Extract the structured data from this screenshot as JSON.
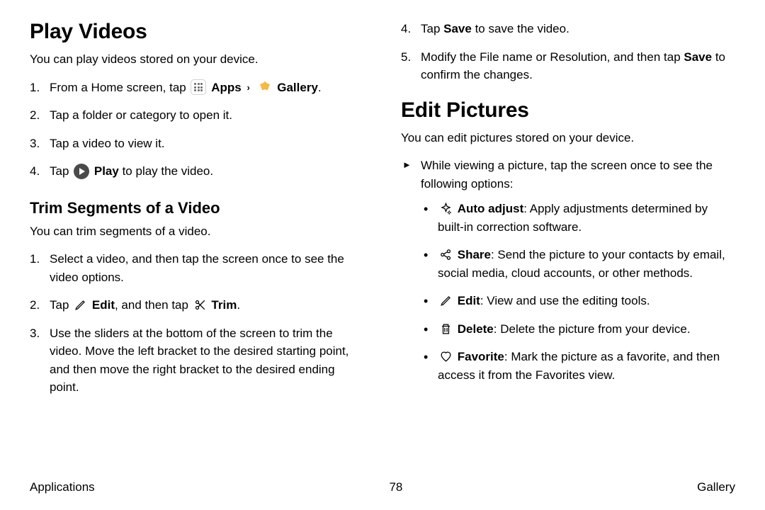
{
  "left": {
    "h1": "Play Videos",
    "intro": "You can play videos stored on your device.",
    "steps": {
      "s1a": "From a Home screen, tap ",
      "s1_apps": "Apps",
      "s1_gallery": "Gallery",
      "s1_end": ".",
      "s2": "Tap a folder or category to open it.",
      "s3": "Tap a video to view it.",
      "s4a": "Tap ",
      "s4_play": "Play",
      "s4b": " to play the video."
    },
    "h2": "Trim Segments of a Video",
    "intro2": "You can trim segments of a video.",
    "trim": {
      "t1": "Select a video, and then tap the screen once to see the video options.",
      "t2a": "Tap ",
      "t2_edit": "Edit",
      "t2b": ", and then tap ",
      "t2_trim": "Trim",
      "t2c": ".",
      "t3": "Use the sliders at the bottom of the screen to trim the video. Move the left bracket to the desired starting point, and then move the right bracket to the desired ending point."
    }
  },
  "right": {
    "cont": {
      "c4a": "Tap ",
      "c4_save": "Save",
      "c4b": " to save the video.",
      "c5a": "Modify the File name or Resolution, and then tap ",
      "c5_save": "Save",
      "c5b": " to confirm the changes."
    },
    "h1": "Edit Pictures",
    "intro": "You can edit pictures stored on your device.",
    "lead": "While viewing a picture, tap the screen once to see the following options:",
    "opts": {
      "auto_l": "Auto adjust",
      "auto_t": ": Apply adjustments determined by built-in correction software.",
      "share_l": "Share",
      "share_t": ": Send the picture to your contacts by email, social media, cloud accounts, or other methods.",
      "edit_l": "Edit",
      "edit_t": ": View and use the editing tools.",
      "del_l": "Delete",
      "del_t": ": Delete the picture from your device.",
      "fav_l": "Favorite",
      "fav_t": ": Mark the picture as a favorite, and then access it from the Favorites view."
    }
  },
  "footer": {
    "left": "Applications",
    "center": "78",
    "right": "Gallery"
  }
}
